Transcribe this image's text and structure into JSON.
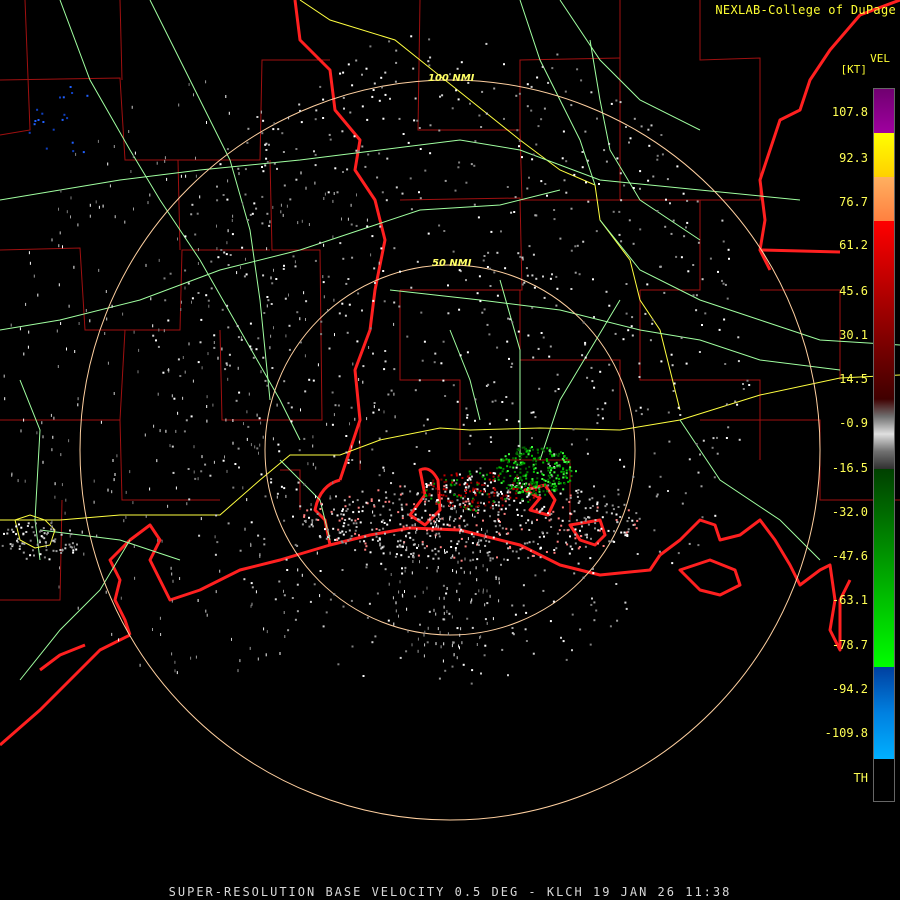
{
  "credit": "NEXLAB-College of DuPage",
  "product": "VEL",
  "units": "[KT]",
  "rings": [
    "100 NMI",
    "50 NMI"
  ],
  "footer": "SUPER-RESOLUTION BASE VELOCITY 0.5 DEG - KLCH 19 JAN 26 11:38",
  "legend": {
    "ticks": [
      "107.8",
      "92.3",
      "76.7",
      "61.2",
      "45.6",
      "30.1",
      "14.5",
      "-0.9",
      "-16.5",
      "-32.0",
      "-47.6",
      "-63.1",
      "-78.7",
      "-94.2",
      "-109.8",
      "TH"
    ],
    "colors": {
      "rf": "#800080",
      "high_outbound": "#ffff00",
      "outbound_orange": "#ffa060",
      "outbound_red": "#ff0000",
      "outbound_dark": "#600000",
      "near_zero": "#c0c0c0",
      "inbound_dark": "#004000",
      "inbound_green": "#00ff00",
      "inbound_blue": "#0060c0",
      "inbound_cyan": "#00a0ff",
      "border_state": "#ff2020",
      "border_county": "#a01010",
      "highway_interstate": "#ffff40",
      "highway_other": "#a0ffa0",
      "range_ring": "#ffd0a0"
    }
  }
}
